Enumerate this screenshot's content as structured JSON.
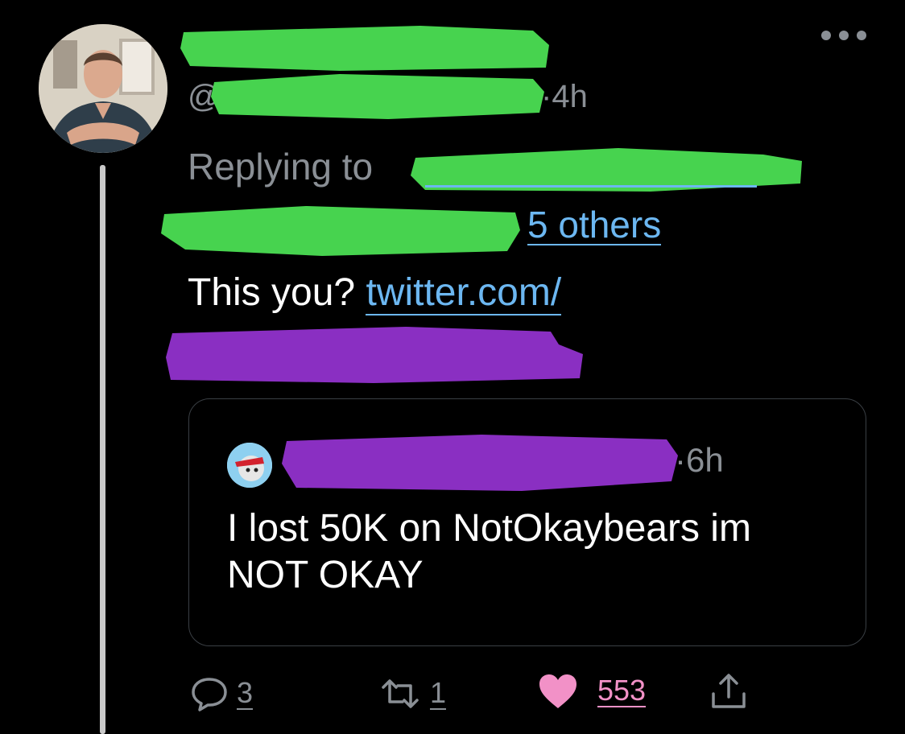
{
  "tweet": {
    "handle_prefix": "@",
    "time": "4h",
    "replying_label": "Replying to",
    "others_label": "5 others",
    "text": "This you?",
    "link_text": "twitter.com/"
  },
  "quote": {
    "time": "6h",
    "text": "I lost 50K on NotOkaybears im NOT OKAY"
  },
  "actions": {
    "replies": "3",
    "retweets": "1",
    "likes": "553"
  },
  "colors": {
    "background": "#000000",
    "secondary_text": "#8a8f95",
    "link": "#6cb7f1",
    "like": "#f291c7",
    "redact_green": "#47d34f",
    "redact_purple": "#8a2fc2"
  }
}
